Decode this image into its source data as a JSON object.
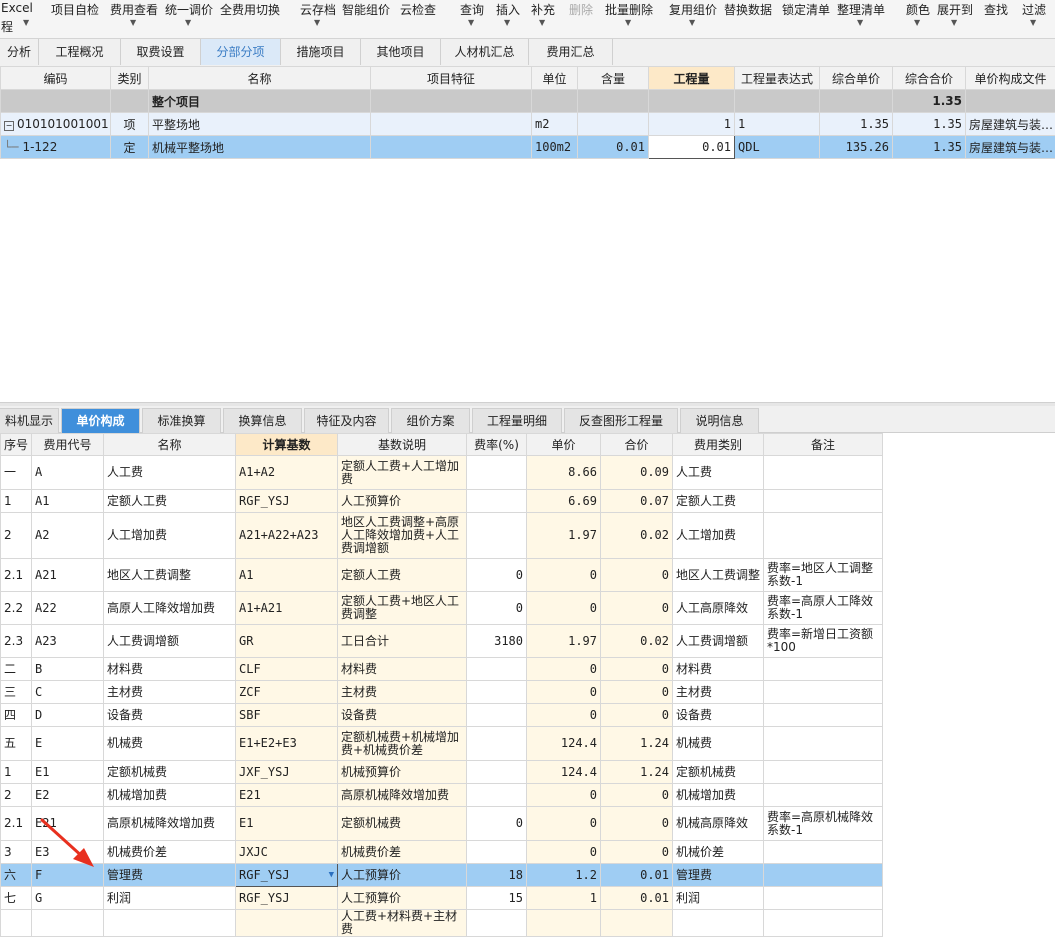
{
  "toolbar": {
    "items": [
      {
        "label": "Excel",
        "label2": "程"
      },
      {
        "label": "项目自检"
      },
      {
        "label": "费用查看"
      },
      {
        "label": "统一调价"
      },
      {
        "label": "全费用切换"
      },
      {
        "label": "云存档"
      },
      {
        "label": "智能组价"
      },
      {
        "label": "云检查"
      },
      {
        "label": "查询"
      },
      {
        "label": "插入"
      },
      {
        "label": "补充"
      },
      {
        "label": "删除"
      },
      {
        "label": "批量删除"
      },
      {
        "label": "复用组价"
      },
      {
        "label": "替换数据"
      },
      {
        "label": "锁定清单"
      },
      {
        "label": "整理清单"
      },
      {
        "label": "颜色"
      },
      {
        "label": "展开到"
      },
      {
        "label": "查找"
      },
      {
        "label": "过滤"
      }
    ]
  },
  "top_tabs": [
    "分析",
    "工程概况",
    "取费设置",
    "分部分项",
    "措施项目",
    "其他项目",
    "人材机汇总",
    "费用汇总"
  ],
  "top_table": {
    "headers": [
      "编码",
      "类别",
      "名称",
      "项目特征",
      "单位",
      "含量",
      "工程量",
      "工程量表达式",
      "综合单价",
      "综合合价",
      "单价构成文件"
    ],
    "summary": {
      "name": "整个项目",
      "total": "1.35"
    },
    "rows": [
      {
        "code": "010101001001",
        "type": "项",
        "name": "平整场地",
        "feature": "",
        "unit": "m2",
        "content": "",
        "qty": "1",
        "expr": "1",
        "unit_price": "1.35",
        "total": "1.35",
        "file": "房屋建筑与装…"
      },
      {
        "code": "1-122",
        "type": "定",
        "name": "机械平整场地",
        "feature": "",
        "unit": "100m2",
        "content": "0.01",
        "qty": "0.01",
        "expr": "QDL",
        "unit_price": "135.26",
        "total": "1.35",
        "file": "房屋建筑与装…"
      }
    ]
  },
  "bottom_tabs": [
    "料机显示",
    "单价构成",
    "标准换算",
    "换算信息",
    "特征及内容",
    "组价方案",
    "工程量明细",
    "反查图形工程量",
    "说明信息"
  ],
  "bottom_table": {
    "headers": [
      "序号",
      "费用代号",
      "名称",
      "计算基数",
      "基数说明",
      "费率(%)",
      "单价",
      "合价",
      "费用类别",
      "备注"
    ],
    "rows": [
      {
        "seq": "一",
        "code": "A",
        "name": "人工费",
        "base": "A1+A2",
        "desc": "定额人工费+人工增加费",
        "rate": "",
        "price": "8.66",
        "total": "0.09",
        "cat": "人工费",
        "note": ""
      },
      {
        "seq": "1",
        "code": "A1",
        "name": "定额人工费",
        "base": "RGF_YSJ",
        "desc": "人工预算价",
        "rate": "",
        "price": "6.69",
        "total": "0.07",
        "cat": "定额人工费",
        "note": ""
      },
      {
        "seq": "2",
        "code": "A2",
        "name": "人工增加费",
        "base": "A21+A22+A23",
        "desc": "地区人工费调整+高原人工降效增加费+人工费调增额",
        "rate": "",
        "price": "1.97",
        "total": "0.02",
        "cat": "人工增加费",
        "note": ""
      },
      {
        "seq": "2.1",
        "code": "A21",
        "name": "地区人工费调整",
        "base": "A1",
        "desc": "定额人工费",
        "rate": "0",
        "price": "0",
        "total": "0",
        "cat": "地区人工费调整",
        "note": "费率=地区人工调整系数-1"
      },
      {
        "seq": "2.2",
        "code": "A22",
        "name": "高原人工降效增加费",
        "base": "A1+A21",
        "desc": "定额人工费+地区人工费调整",
        "rate": "0",
        "price": "0",
        "total": "0",
        "cat": "人工高原降效",
        "note": "费率=高原人工降效系数-1"
      },
      {
        "seq": "2.3",
        "code": "A23",
        "name": "人工费调增额",
        "base": "GR",
        "desc": "工日合计",
        "rate": "3180",
        "price": "1.97",
        "total": "0.02",
        "cat": "人工费调增额",
        "note": "费率=新增日工资额*100"
      },
      {
        "seq": "二",
        "code": "B",
        "name": "材料费",
        "base": "CLF",
        "desc": "材料费",
        "rate": "",
        "price": "0",
        "total": "0",
        "cat": "材料费",
        "note": ""
      },
      {
        "seq": "三",
        "code": "C",
        "name": "主材费",
        "base": "ZCF",
        "desc": "主材费",
        "rate": "",
        "price": "0",
        "total": "0",
        "cat": "主材费",
        "note": ""
      },
      {
        "seq": "四",
        "code": "D",
        "name": "设备费",
        "base": "SBF",
        "desc": "设备费",
        "rate": "",
        "price": "0",
        "total": "0",
        "cat": "设备费",
        "note": ""
      },
      {
        "seq": "五",
        "code": "E",
        "name": "机械费",
        "base": "E1+E2+E3",
        "desc": "定额机械费+机械增加费+机械费价差",
        "rate": "",
        "price": "124.4",
        "total": "1.24",
        "cat": "机械费",
        "note": ""
      },
      {
        "seq": "1",
        "code": "E1",
        "name": "定额机械费",
        "base": "JXF_YSJ",
        "desc": "机械预算价",
        "rate": "",
        "price": "124.4",
        "total": "1.24",
        "cat": "定额机械费",
        "note": ""
      },
      {
        "seq": "2",
        "code": "E2",
        "name": "机械增加费",
        "base": "E21",
        "desc": "高原机械降效增加费",
        "rate": "",
        "price": "0",
        "total": "0",
        "cat": "机械增加费",
        "note": ""
      },
      {
        "seq": "2.1",
        "code": "E21",
        "name": "高原机械降效增加费",
        "base": "E1",
        "desc": "定额机械费",
        "rate": "0",
        "price": "0",
        "total": "0",
        "cat": "机械高原降效",
        "note": "费率=高原机械降效系数-1"
      },
      {
        "seq": "3",
        "code": "E3",
        "name": "机械费价差",
        "base": "JXJC",
        "desc": "机械费价差",
        "rate": "",
        "price": "0",
        "total": "0",
        "cat": "机械价差",
        "note": ""
      },
      {
        "seq": "六",
        "code": "F",
        "name": "管理费",
        "base": "RGF_YSJ",
        "desc": "人工预算价",
        "rate": "18",
        "price": "1.2",
        "total": "0.01",
        "cat": "管理费",
        "note": ""
      },
      {
        "seq": "七",
        "code": "G",
        "name": "利润",
        "base": "RGF_YSJ",
        "desc": "人工预算价",
        "rate": "15",
        "price": "1",
        "total": "0.01",
        "cat": "利润",
        "note": ""
      },
      {
        "seq": "",
        "code": "",
        "name": "",
        "base": "",
        "desc": "人工费+材料费+主材费",
        "rate": "",
        "price": "",
        "total": "",
        "cat": "",
        "note": ""
      }
    ]
  }
}
